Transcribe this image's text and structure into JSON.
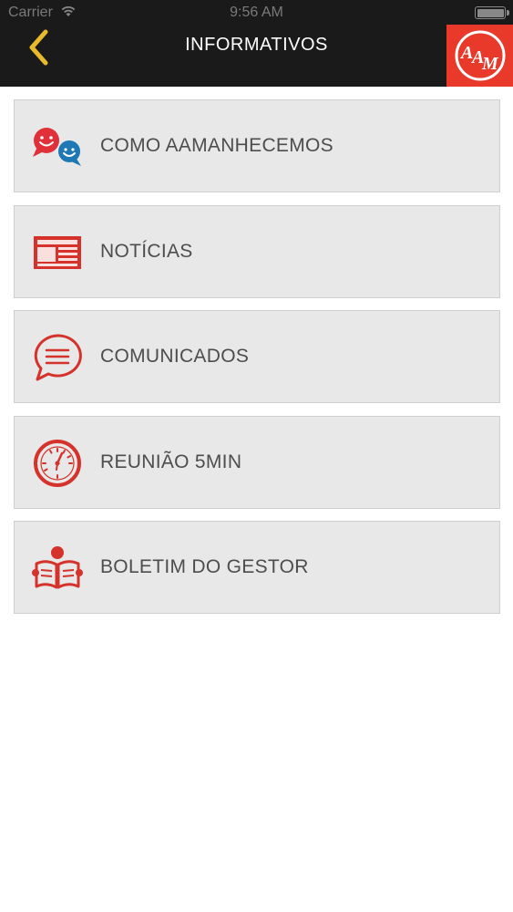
{
  "status_bar": {
    "carrier": "Carrier",
    "time": "9:56 AM"
  },
  "header": {
    "title": "INFORMATIVOS",
    "back_icon": "chevron-left-icon",
    "logo_text": "AAM",
    "background": "#1a1a1a",
    "accent": "#e8b92a",
    "logo_color": "#e8392a"
  },
  "menu": {
    "items": [
      {
        "label": "COMO AAMANHECEMOS",
        "icon": "chat-faces-icon"
      },
      {
        "label": "NOTÍCIAS",
        "icon": "newspaper-icon"
      },
      {
        "label": "COMUNICADOS",
        "icon": "message-bubble-icon"
      },
      {
        "label": "REUNIÃO 5MIN",
        "icon": "clock-icon"
      },
      {
        "label": "BOLETIM DO GESTOR",
        "icon": "reader-book-icon"
      }
    ],
    "item_background": "#e8e8e8",
    "icon_color": "#d4322b"
  }
}
